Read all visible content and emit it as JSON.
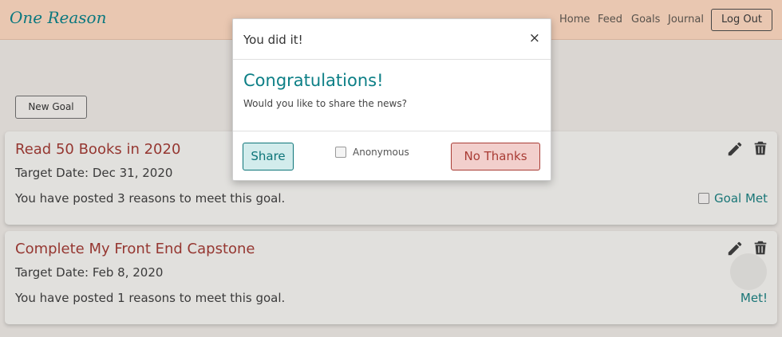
{
  "nav": {
    "brand": "One Reason",
    "links": [
      "Home",
      "Feed",
      "Goals",
      "Journal"
    ],
    "logout_label": "Log Out"
  },
  "page": {
    "new_goal_label": "New Goal"
  },
  "goals": [
    {
      "title": "Read 50 Books in 2020",
      "target_date": "Target Date: Dec 31, 2020",
      "posts_text": "You have posted 3 reasons to meet this goal.",
      "status_label": "Goal Met"
    },
    {
      "title": "Complete My Front End Capstone",
      "target_date": "Target Date: Feb 8, 2020",
      "posts_text": "You have posted 1 reasons to meet this goal.",
      "status_label": "Met!"
    }
  ],
  "modal": {
    "title": "You did it!",
    "close_label": "×",
    "heading": "Congratulations!",
    "text": "Would you like to share the news?",
    "share_label": "Share",
    "anonymous_label": "Anonymous",
    "no_thanks_label": "No Thanks"
  },
  "icons": {
    "edit": "pencil-icon",
    "delete": "trash-icon"
  },
  "colors": {
    "navbar": "#f6d2bb",
    "brand": "#0c7f86",
    "goal_title": "#9e3a34",
    "teal": "#0d7579",
    "danger": "#a93c35"
  }
}
